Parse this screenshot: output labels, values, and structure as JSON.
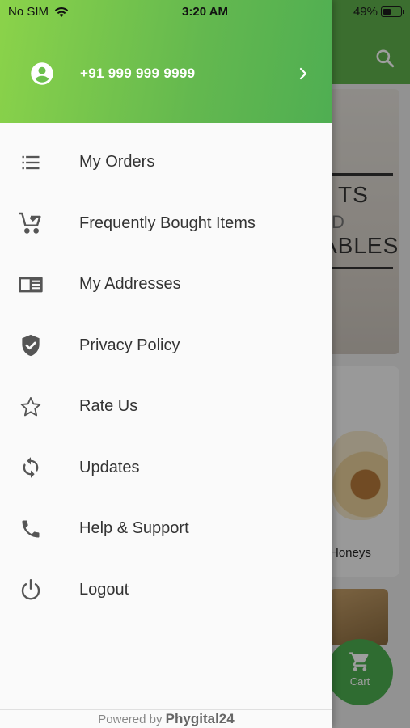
{
  "status_bar": {
    "carrier": "No SIM",
    "time": "3:20 AM",
    "battery_text": "49%",
    "battery_level": 0.49
  },
  "drawer": {
    "phone": "+91 999 999 9999",
    "menu": [
      {
        "label": "My Orders",
        "icon": "list-icon"
      },
      {
        "label": "Frequently Bought Items",
        "icon": "cart-heart-icon"
      },
      {
        "label": "My Addresses",
        "icon": "address-card-icon"
      },
      {
        "label": "Privacy Policy",
        "icon": "shield-check-icon"
      },
      {
        "label": "Rate Us",
        "icon": "star-icon"
      },
      {
        "label": "Updates",
        "icon": "sync-icon"
      },
      {
        "label": "Help & Support",
        "icon": "phone-icon"
      },
      {
        "label": "Logout",
        "icon": "power-icon"
      }
    ],
    "footer_prefix": "Powered by",
    "footer_brand": "Phygital24"
  },
  "background": {
    "banner_line1": "TS",
    "banner_line2": "D",
    "banner_line3": "ABLES",
    "card_label": "Honeys",
    "cart_label": "Cart"
  },
  "colors": {
    "header_start": "#8bd34a",
    "header_end": "#4fae52",
    "icon": "#555555"
  }
}
